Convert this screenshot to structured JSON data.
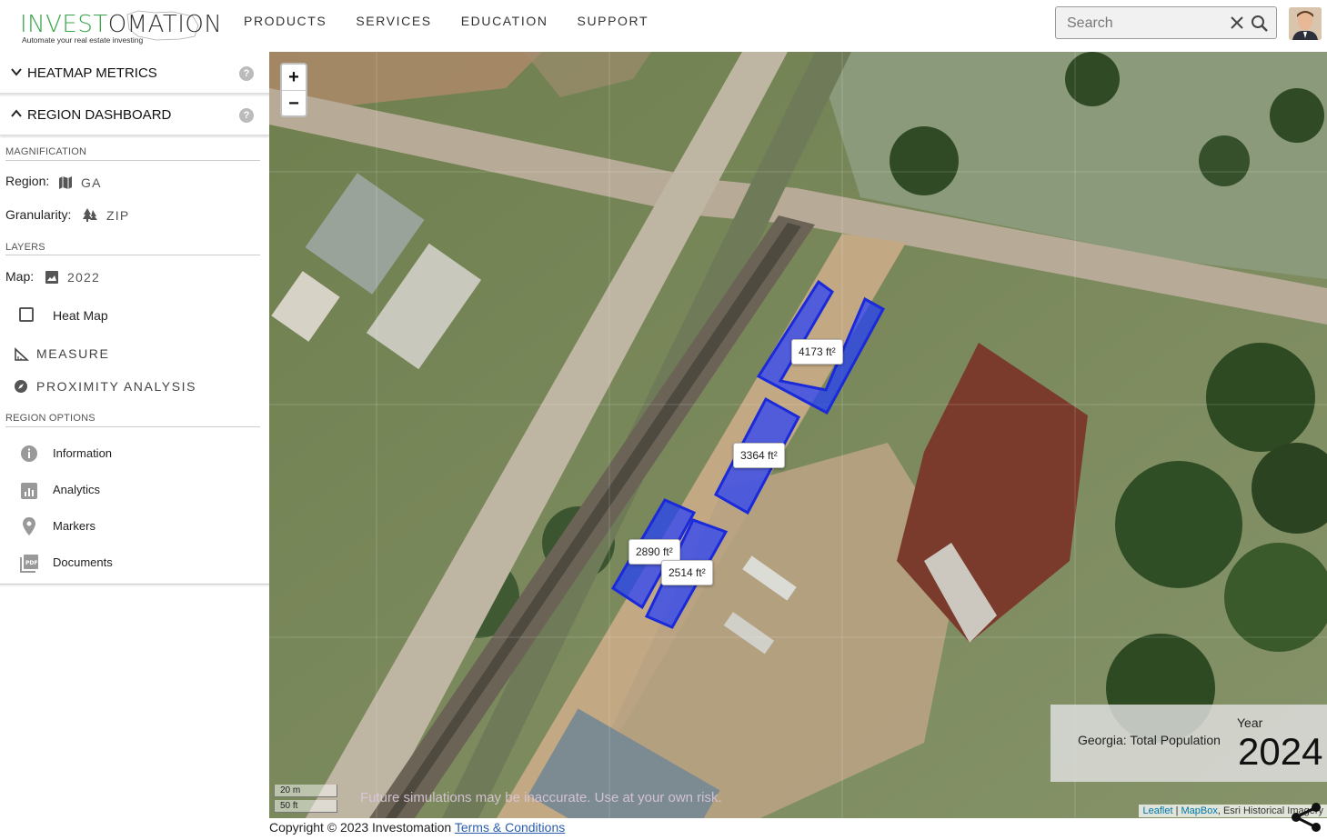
{
  "header": {
    "logo": {
      "green": "INVEST",
      "dark": "OMATION",
      "tagline": "Automate your real estate investing"
    },
    "nav": [
      "PRODUCTS",
      "SERVICES",
      "EDUCATION",
      "SUPPORT"
    ],
    "search": {
      "placeholder": "Search",
      "value": ""
    }
  },
  "sidebar": {
    "heatmap_metrics": "HEATMAP METRICS",
    "region_dashboard": "REGION DASHBOARD",
    "help": "?",
    "magnification": {
      "title": "MAGNIFICATION",
      "region_label": "Region:",
      "region_value": "GA",
      "granularity_label": "Granularity:",
      "granularity_value": "ZIP"
    },
    "layers": {
      "title": "LAYERS",
      "map_label": "Map:",
      "map_value": "2022",
      "heatmap_label": "Heat Map",
      "heatmap_checked": false,
      "measure": "MEASURE",
      "proximity": "PROXIMITY ANALYSIS"
    },
    "region_options": {
      "title": "REGION OPTIONS",
      "items": [
        "Information",
        "Analytics",
        "Markers",
        "Documents"
      ]
    }
  },
  "map": {
    "zoom_in": "+",
    "zoom_out": "−",
    "areas": [
      "4173 ft²",
      "3364 ft²",
      "2890 ft²",
      "2514 ft²"
    ],
    "population": {
      "name": "Georgia: Total Population",
      "year_label": "Year",
      "year": "2024"
    },
    "scale_m": "20 m",
    "scale_ft": "50 ft",
    "warning": "Future simulations may be inaccurate. Use at your own risk.",
    "attribution": {
      "leaflet": "Leaflet",
      "sep": " | ",
      "mapbox": "MapBox",
      "rest": ", Esri Historical Imagery"
    },
    "colors": {
      "polygon_fill": "#1f3cff",
      "polygon_stroke": "#1a2ad8"
    }
  },
  "footer": {
    "copyright": "Copyright © 2023 Investomation",
    "terms": "Terms & Conditions"
  }
}
